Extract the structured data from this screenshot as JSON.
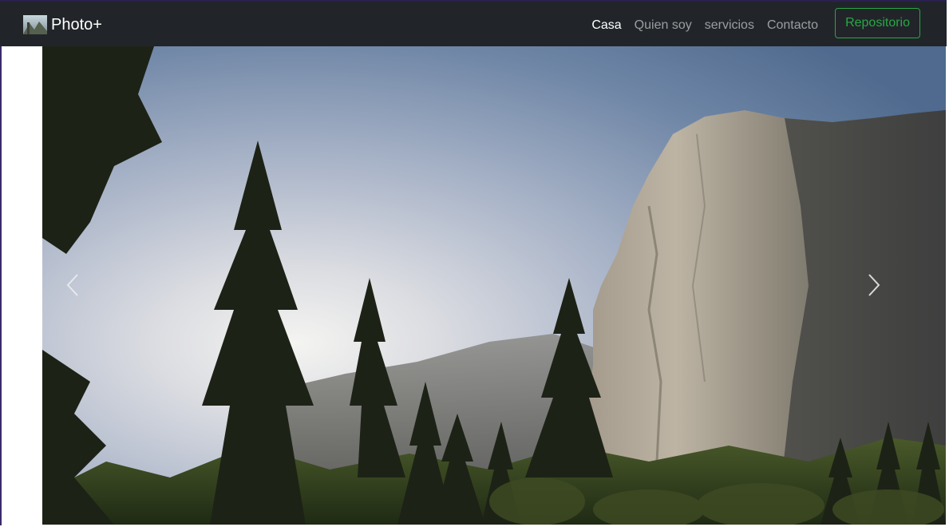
{
  "navbar": {
    "brand": {
      "logo_icon": "photo-thumbnail-icon",
      "text": "Photo+"
    },
    "links": [
      {
        "label": "Casa",
        "active": true
      },
      {
        "label": "Quien soy",
        "active": false
      },
      {
        "label": "servicios",
        "active": false
      },
      {
        "label": "Contacto",
        "active": false
      }
    ],
    "repo_button_label": "Repositorio"
  },
  "carousel": {
    "slide_image": "mountain-cliff-forest-photo",
    "prev_icon": "chevron-left-icon",
    "next_icon": "chevron-right-icon"
  },
  "colors": {
    "navbar_bg": "#212529",
    "link_active": "#ffffff",
    "link_inactive": "#9a9da0",
    "repo_accent": "#28a745"
  }
}
